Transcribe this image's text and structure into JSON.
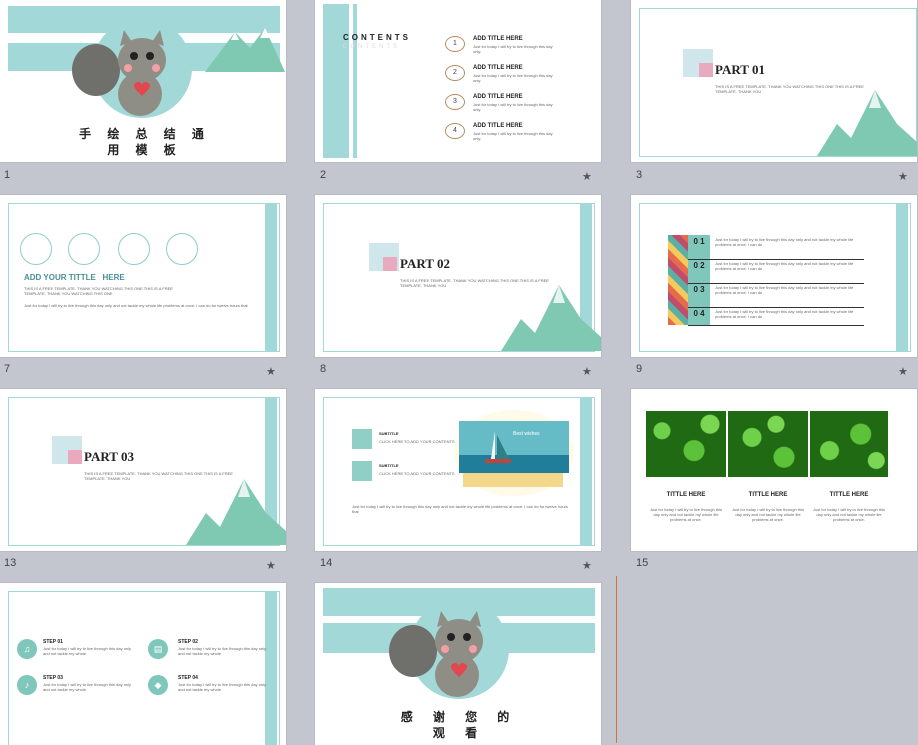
{
  "slides": {
    "s1": {
      "number": "1",
      "title": "手 绘 总 结 通 用 模 板"
    },
    "s2": {
      "number": "2",
      "contents": "CONTENTS",
      "contents_shadow": "CONTENTS",
      "items": [
        {
          "num": "1",
          "title": "ADD TITLE HERE",
          "text": "Just for today I will try to live through this day only."
        },
        {
          "num": "2",
          "title": "ADD TITLE HERE",
          "text": "Just for today I will try to live through this day only."
        },
        {
          "num": "3",
          "title": "ADD TITLE HERE",
          "text": "Just for today I will try to live through this day only."
        },
        {
          "num": "4",
          "title": "ADD TITLE HERE",
          "text": "Just for today I will try to live through this day only."
        }
      ]
    },
    "s3": {
      "number": "3",
      "part": "PART 01",
      "desc": "THIS IS A FREE TEMPLATE. THANK YOU WATCHING THIS ONE THIS IS A FREE TEMPLATE. THANK YOU"
    },
    "s7": {
      "number": "7",
      "heading": "ADD YOUR TITTLE   HERE",
      "lines": [
        "THIS IS A FREE TEMPLATE. THANK YOU WATCHING THIS ONE THIS IS A FREE",
        "TEMPLATE. THANK YOU WATCHING THIS ONE"
      ],
      "body": "Just for today I will try to live through this day only and not tackle my whole life problems at once. I can do for twelve hours that"
    },
    "s8": {
      "number": "8",
      "part": "PART 02",
      "desc": "THIS IS A FREE TEMPLATE. THANK YOU WATCHING THIS ONE THIS IS A FREE TEMPLATE. THANK YOU"
    },
    "s9": {
      "number": "9",
      "rows": [
        {
          "label": "0 1",
          "text": "Just for today I will try to live through this day only and not tackle my whole life problems at once. I can do"
        },
        {
          "label": "0 2",
          "text": "Just for today I will try to live through this day only and not tackle my whole life problems at once. I can do"
        },
        {
          "label": "0 3",
          "text": "Just for today I will try to live through this day only and not tackle my whole life problems at once. I can do"
        },
        {
          "label": "0 4",
          "text": "Just for today I will try to live through this day only and not tackle my whole life problems at once. I can do"
        }
      ]
    },
    "s13": {
      "number": "13",
      "part": "PART 03",
      "desc": "THIS IS A FREE TEMPLATE. THANK YOU WATCHING THIS ONE THIS IS A FREE TEMPLATE. THANK YOU"
    },
    "s14": {
      "number": "14",
      "item1_title": "SUBTITLE",
      "item1_text": "CLICK HERE TO ADD YOUR CONTENTS",
      "item2_title": "SUBTITLE",
      "item2_text": "CLICK HERE TO ADD YOUR CONTENTS",
      "sail_text": "Best wishes",
      "body": "Just for today I will try to live through this day only and not tackle my whole life problems at once. I can do for twelve hours that"
    },
    "s15": {
      "number": "15",
      "titles": [
        "TITTLE HERE",
        "TITTLE HERE",
        "TITTLE HERE"
      ],
      "text": "Just for today I will try to live through this day only and not tackle my whole life problems at once."
    },
    "s16": {
      "steps": [
        {
          "title": "STEP 01",
          "text": "Just for today I will try to live through this day only and not tackle my whole"
        },
        {
          "title": "STEP 02",
          "text": "Just for today I will try to live through this day only and not tackle my whole"
        },
        {
          "title": "STEP 03",
          "text": "Just for today I will try to live through this day only and not tackle my whole"
        },
        {
          "title": "STEP 04",
          "text": "Just for today I will try to live through this day only and not tackle my whole"
        }
      ]
    },
    "s17": {
      "title": "感 谢 您 的 观 看"
    }
  },
  "colors": {
    "accent": "#a3d8d8",
    "mountain": "#7fc8b2",
    "pink": "#e9a9bf",
    "green": "#2f8a1e"
  },
  "icons": {
    "star": "★"
  }
}
